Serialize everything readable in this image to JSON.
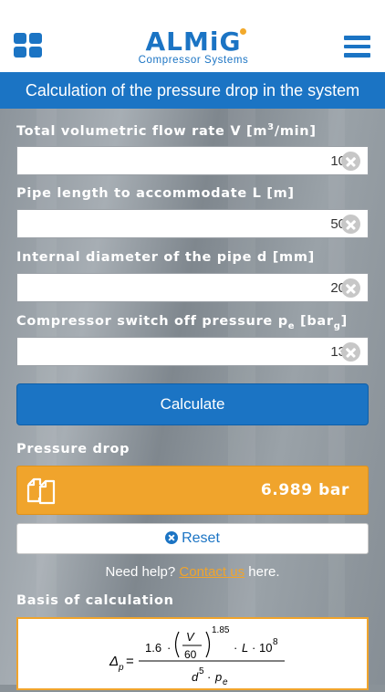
{
  "header": {
    "logo_text": "ALMiG",
    "logo_subtitle": "Compressor Systems",
    "apps_icon": "grid-icon",
    "menu_icon": "hamburger-menu-icon"
  },
  "page": {
    "title": "Calculation of the pressure drop in the system"
  },
  "form": {
    "flow_rate": {
      "label": "Total volumetric flow rate V [m",
      "label_sup": "3",
      "label_end": "/min]",
      "value": "10"
    },
    "pipe_length": {
      "label": "Pipe length to accommodate L [m]",
      "value": "50"
    },
    "diameter": {
      "label": "Internal diameter of the pipe d [mm]",
      "value": "20"
    },
    "pressure": {
      "label": "Compressor switch off pressure p",
      "label_sub": "e",
      "label_mid": " [bar",
      "label_sub2": "g",
      "label_end": "]",
      "value": "13"
    },
    "calculate_label": "Calculate"
  },
  "result": {
    "label": "Pressure drop",
    "value": "6.989 bar",
    "copy_icon": "copy-icon"
  },
  "reset_label": "Reset",
  "help": {
    "prefix": "Need help? ",
    "link": "Contact us",
    "suffix": " here."
  },
  "basis": {
    "label": "Basis of calculation",
    "formula": {
      "lhs": "Δ",
      "lhs_sub": "p",
      "coef": "1.6",
      "v": "V",
      "denom60": "60",
      "exp": "1.85",
      "l": "L",
      "ten": "10",
      "ten_exp": "8",
      "d": "d",
      "d_exp": "5",
      "p": "p",
      "p_sub": "e"
    }
  },
  "colors": {
    "brand_blue": "#1b74c4",
    "accent_orange": "#f0a42c"
  }
}
